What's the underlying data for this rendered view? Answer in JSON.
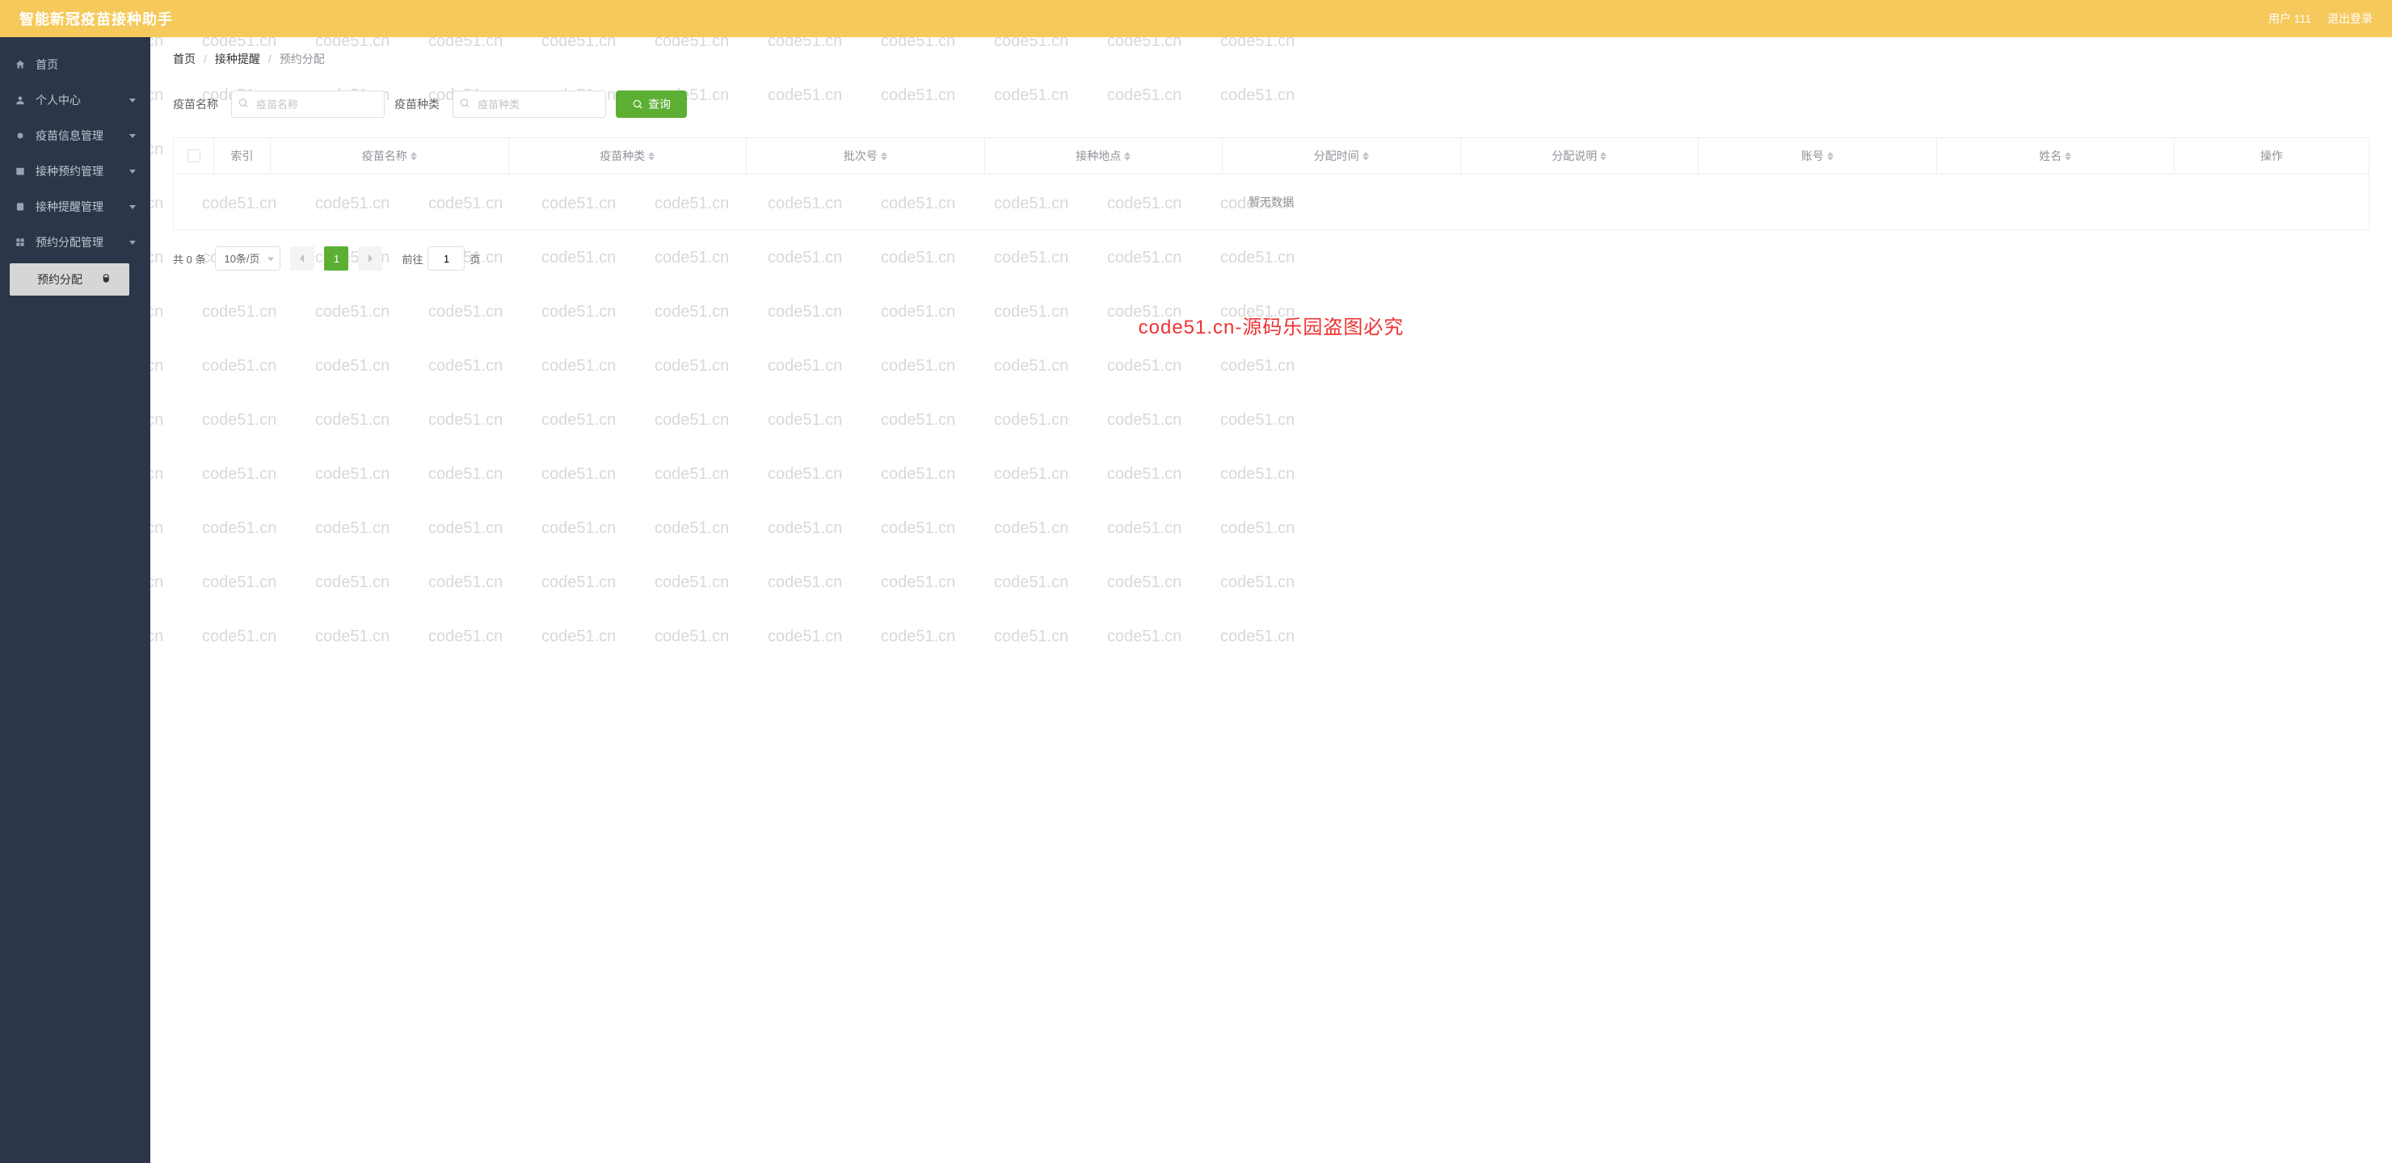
{
  "watermark": "code51.cn",
  "header": {
    "title": "智能新冠疫苗接种助手",
    "user_label": "用户 111",
    "logout": "退出登录"
  },
  "sidebar": [
    {
      "icon": "home",
      "label": "首页",
      "children": false
    },
    {
      "icon": "user",
      "label": "个人中心",
      "children": true
    },
    {
      "icon": "vaccine",
      "label": "疫苗信息管理",
      "children": true
    },
    {
      "icon": "calendar",
      "label": "接种预约管理",
      "children": true
    },
    {
      "icon": "bell",
      "label": "接种提醒管理",
      "children": true
    },
    {
      "icon": "grid",
      "label": "预约分配管理",
      "children": true,
      "expanded": true,
      "sub": [
        {
          "label": "预约分配"
        }
      ]
    }
  ],
  "breadcrumb": [
    "首页",
    "接种提醒",
    "预约分配"
  ],
  "search": {
    "name_label": "疫苗名称",
    "name_placeholder": "疫苗名称",
    "type_label": "疫苗种类",
    "type_placeholder": "疫苗种类",
    "button": "查询"
  },
  "table": {
    "columns": [
      "索引",
      "疫苗名称",
      "疫苗种类",
      "批次号",
      "接种地点",
      "分配时间",
      "分配说明",
      "账号",
      "姓名",
      "操作"
    ],
    "empty": "暂无数据"
  },
  "pager": {
    "total_text": "共 0 条",
    "page_size": "10条/页",
    "current": "1",
    "jump_prefix": "前往",
    "jump_value": "1",
    "jump_suffix": "页"
  },
  "overlay_text": "code51.cn-源码乐园盗图必究"
}
